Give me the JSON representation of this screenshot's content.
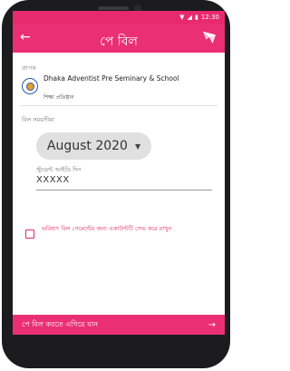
{
  "status": {
    "time": "12:30"
  },
  "appbar": {
    "title": "পে বিল"
  },
  "recipient": {
    "label": "প্রাপক",
    "name": "Dhaka Adventist Pre Seminary & School",
    "type": "শিক্ষা প্রতিষ্ঠান"
  },
  "bill_period": {
    "label": "বিল সময়সীমা",
    "selected": "August 2020"
  },
  "student_id": {
    "label": "স্টুডেন্ট আইডি দিন",
    "value": "XXXXX"
  },
  "save_account": {
    "label": "ভবিষ্যৎ বিল পেমেন্টের জন্য একাউন্টটি সেভ করে রাখুন",
    "checked": false
  },
  "footer": {
    "proceed_label": "পে বিল করতে এগিয়ে যান"
  },
  "colors": {
    "accent": "#ea2f74"
  }
}
